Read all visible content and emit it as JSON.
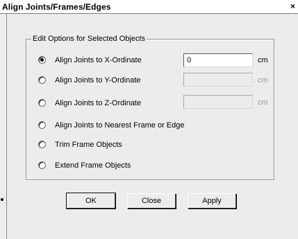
{
  "window": {
    "title": "Align Joints/Frames/Edges",
    "close_glyph": "×"
  },
  "group": {
    "legend": "Edit Options for Selected Objects"
  },
  "options": [
    {
      "label": "Align Joints to X-Ordinate",
      "selected": true,
      "value": "0",
      "unit": "cm",
      "enabled": true
    },
    {
      "label": "Align Joints to Y-Ordinate",
      "selected": false,
      "value": "",
      "unit": "cm",
      "enabled": false
    },
    {
      "label": "Align Joints to Z-Ordinate",
      "selected": false,
      "value": "",
      "unit": "cm",
      "enabled": false
    },
    {
      "label": "Align Joints to Nearest Frame or Edge",
      "selected": false
    },
    {
      "label": "Trim Frame Objects",
      "selected": false
    },
    {
      "label": "Extend Frame Objects",
      "selected": false
    }
  ],
  "buttons": {
    "ok": "OK",
    "close": "Close",
    "apply": "Apply"
  }
}
